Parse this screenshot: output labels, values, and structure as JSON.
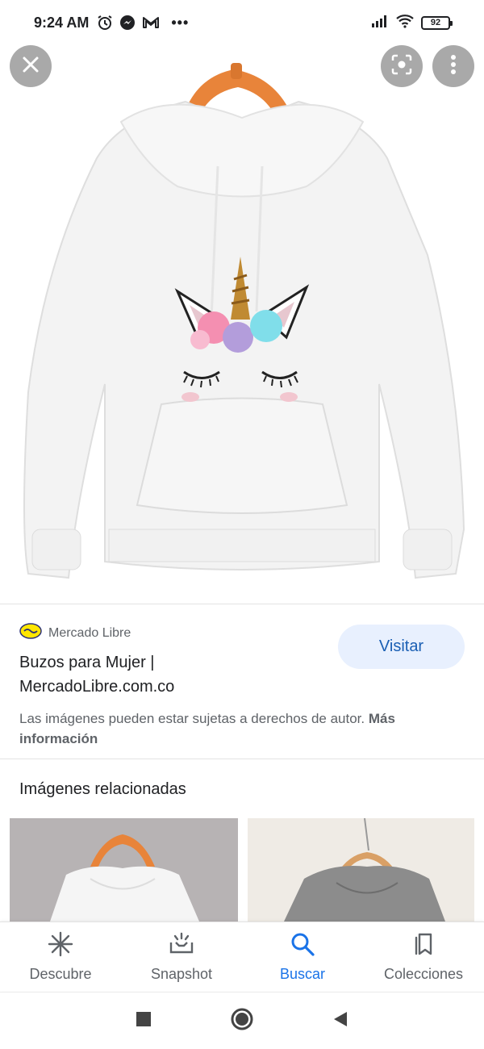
{
  "status_bar": {
    "time": "9:24 AM",
    "dots": "•••",
    "battery": "92",
    "icons": [
      "alarm-icon",
      "messenger-icon",
      "gmail-icon",
      "signal-icon",
      "wifi-icon",
      "battery-icon"
    ]
  },
  "image_viewer": {
    "icons": [
      "close-icon",
      "lens-icon",
      "more-vert-icon"
    ]
  },
  "result": {
    "source_name": "Mercado Libre",
    "title_line1": "Buzos para Mujer |",
    "title_line2": "MercadoLibre.com.co",
    "visit_label": "Visitar",
    "copyright_text": "Las imágenes pueden estar sujetas a derechos de autor.",
    "more_info_label": "Más información"
  },
  "related": {
    "title": "Imágenes relacionadas"
  },
  "bottom_nav": {
    "items": [
      {
        "label": "Descubre",
        "icon": "asterisk-icon",
        "active": false
      },
      {
        "label": "Snapshot",
        "icon": "snapshot-icon",
        "active": false
      },
      {
        "label": "Buscar",
        "icon": "search-icon",
        "active": true
      },
      {
        "label": "Colecciones",
        "icon": "collections-icon",
        "active": false
      }
    ]
  },
  "system_nav": {
    "icons": [
      "recents-icon",
      "home-icon",
      "back-icon"
    ]
  },
  "colors": {
    "accent": "#1a73e8",
    "visit_bg": "#e8f0fe",
    "visit_text": "#1a5fb4",
    "secondary_text": "#5f6368"
  }
}
